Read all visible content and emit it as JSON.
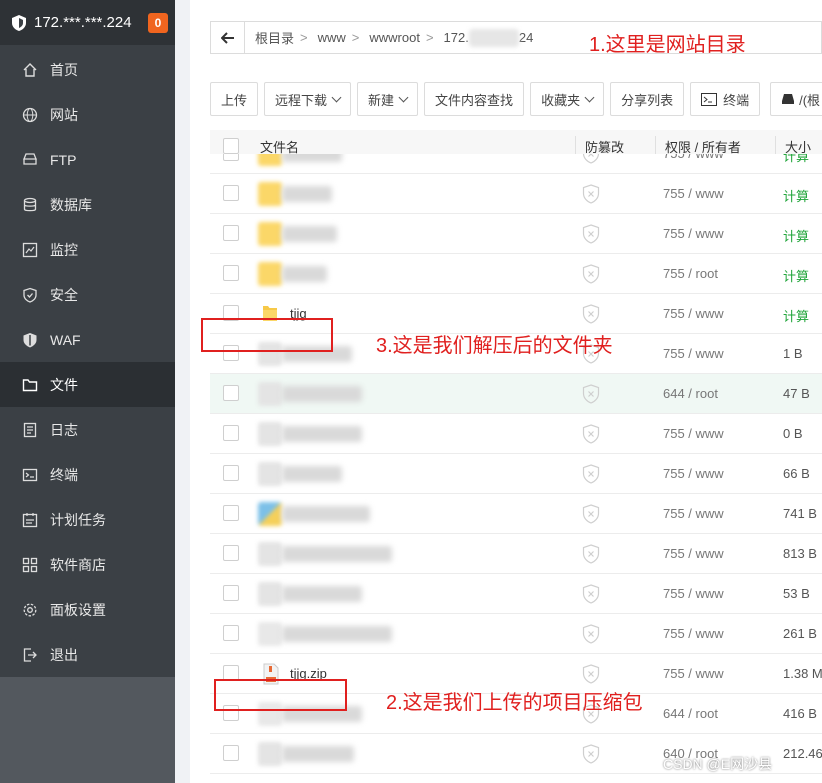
{
  "sidebar": {
    "server_ip": "172.***.***.224",
    "badge": "0",
    "items": [
      {
        "label": "首页",
        "icon": "home-icon"
      },
      {
        "label": "网站",
        "icon": "globe-icon"
      },
      {
        "label": "FTP",
        "icon": "ftp-icon"
      },
      {
        "label": "数据库",
        "icon": "database-icon"
      },
      {
        "label": "监控",
        "icon": "monitor-icon"
      },
      {
        "label": "安全",
        "icon": "shield-icon"
      },
      {
        "label": "WAF",
        "icon": "waf-icon"
      },
      {
        "label": "文件",
        "icon": "folder-icon"
      },
      {
        "label": "日志",
        "icon": "log-icon"
      },
      {
        "label": "终端",
        "icon": "terminal-icon"
      },
      {
        "label": "计划任务",
        "icon": "calendar-icon"
      },
      {
        "label": "软件商店",
        "icon": "grid-icon"
      },
      {
        "label": "面板设置",
        "icon": "gear-icon"
      },
      {
        "label": "退出",
        "icon": "logout-icon"
      }
    ],
    "active_index": 7
  },
  "breadcrumb": {
    "segments": [
      "根目录",
      "www",
      "wwwroot",
      "172.",
      "24"
    ]
  },
  "toolbar": {
    "upload": "上传",
    "remote_download": "远程下载",
    "new": "新建",
    "content_search": "文件内容查找",
    "favorites": "收藏夹",
    "share_list": "分享列表",
    "terminal": "终端",
    "root_path": "/(根目录"
  },
  "table": {
    "headers": {
      "name": "文件名",
      "tamper": "防篡改",
      "perm": "权限 / 所有者",
      "size": "大小"
    },
    "rows": [
      {
        "name": "",
        "type": "folder",
        "perm": "755 / www",
        "size": "计算"
      },
      {
        "name": "",
        "type": "folder",
        "perm": "755 / www",
        "size": "计算"
      },
      {
        "name": "",
        "type": "folder",
        "perm": "755 / www",
        "size": "计算"
      },
      {
        "name": "",
        "type": "folder",
        "perm": "755 / root",
        "size": "计算"
      },
      {
        "name": "tjjg",
        "type": "folder",
        "perm": "755 / www",
        "size": "计算"
      },
      {
        "name": "",
        "type": "file",
        "perm": "755 / www",
        "size": "1 B"
      },
      {
        "name": "",
        "type": "file",
        "perm": "644 / root",
        "size": "47 B"
      },
      {
        "name": "",
        "type": "file",
        "perm": "755 / www",
        "size": "0 B"
      },
      {
        "name": "",
        "type": "file",
        "perm": "755 / www",
        "size": "66 B"
      },
      {
        "name": "",
        "type": "image",
        "perm": "755 / www",
        "size": "741 B"
      },
      {
        "name": "",
        "type": "file",
        "perm": "755 / www",
        "size": "813 B"
      },
      {
        "name": "",
        "type": "file",
        "perm": "755 / www",
        "size": "53 B"
      },
      {
        "name": "",
        "type": "doc",
        "perm": "755 / www",
        "size": "261 B"
      },
      {
        "name": "tjjg.zip",
        "type": "zip",
        "perm": "755 / www",
        "size": "1.38 M"
      },
      {
        "name": "",
        "type": "doc",
        "perm": "644 / root",
        "size": "416 B"
      },
      {
        "name": "",
        "type": "file",
        "perm": "640 / root",
        "size": "212.46"
      }
    ]
  },
  "annotations": {
    "note1": "1.这里是网站目录",
    "note2": "2.这是我们上传的项目压缩包",
    "note3": "3.这是我们解压后的文件夹"
  },
  "watermark": "CSDN @E网沙县",
  "colors": {
    "sidebar_bg": "#3b4045",
    "accent_green": "#20a53a",
    "annotation_red": "#e0201f",
    "badge_orange": "#f0651f"
  }
}
